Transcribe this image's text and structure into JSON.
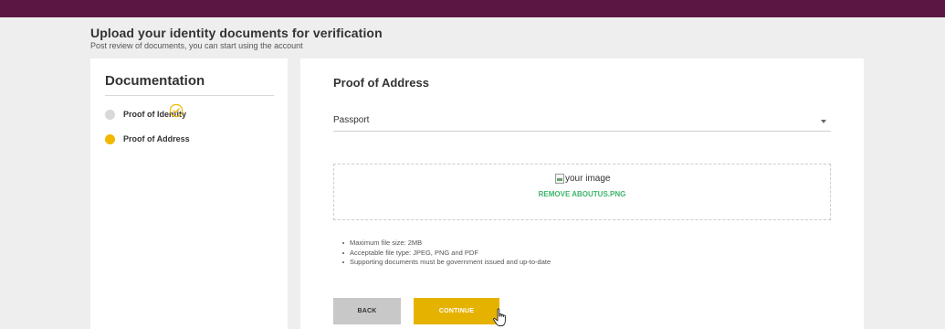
{
  "header": {
    "title": "Upload your identity documents for verification",
    "subtitle": "Post review of documents, you can start using the account"
  },
  "sidebar": {
    "title": "Documentation",
    "steps": [
      {
        "label": "Proof of Identity",
        "status": "completed",
        "dot_color": "#d9d9d9"
      },
      {
        "label": "Proof of Address",
        "status": "active",
        "dot_color": "#f2b800"
      }
    ],
    "check_color": "#f2b800"
  },
  "main": {
    "title": "Proof of Address",
    "document_select": {
      "value": "Passport"
    },
    "upload": {
      "image_alt": "your image",
      "remove_label": "REMOVE ABOUTUS.PNG"
    },
    "hints": [
      "Maximum file size: 2MB",
      "Acceptable file type: JPEG, PNG and PDF",
      "Supporting documents must be government issued and up-to-date"
    ],
    "back_label": "BACK",
    "continue_label": "CONTINUE"
  },
  "colors": {
    "top_bar": "#5b1643",
    "accent": "#e6b200",
    "link": "#3fb56b",
    "background": "#eeeeee"
  },
  "icons": [
    "check-circle-icon",
    "broken-image-icon",
    "chevron-down-icon",
    "hand-cursor-icon"
  ]
}
